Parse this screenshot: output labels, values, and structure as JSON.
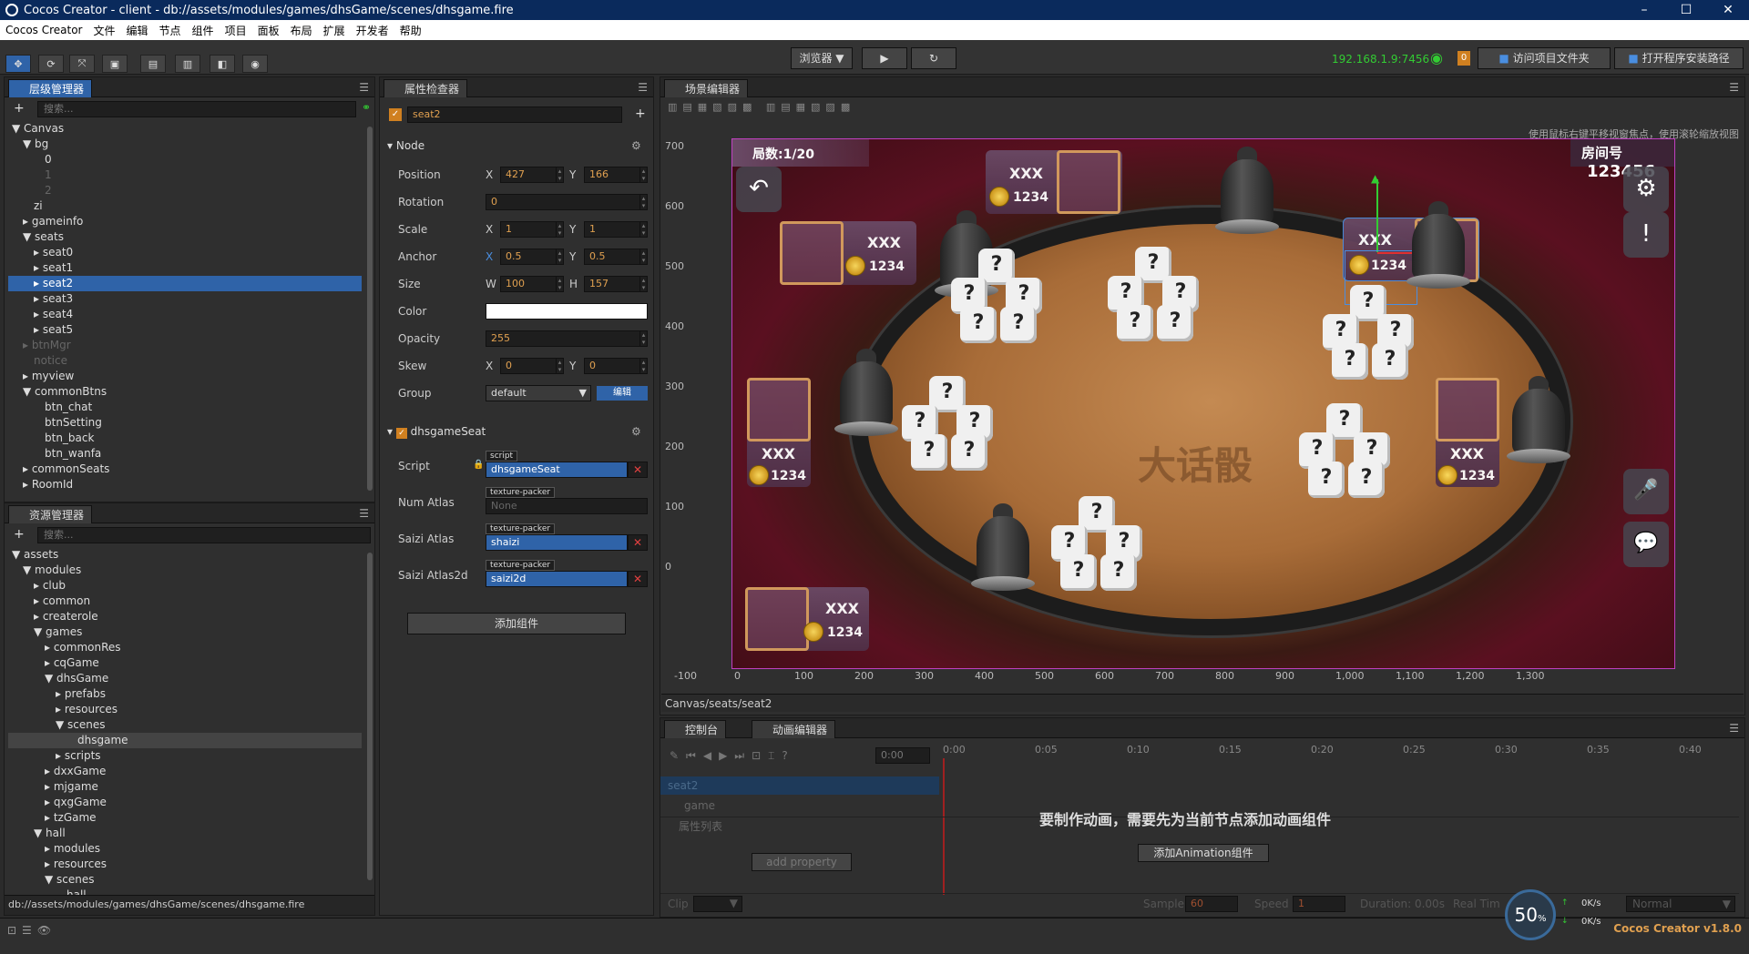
{
  "window": {
    "title": "Cocos Creator - client - db://assets/modules/games/dhsGame/scenes/dhsgame.fire",
    "min": "–",
    "max": "☐",
    "close": "✕"
  },
  "menu": [
    "Cocos Creator",
    "文件",
    "编辑",
    "节点",
    "组件",
    "项目",
    "面板",
    "布局",
    "扩展",
    "开发者",
    "帮助"
  ],
  "toolbar": {
    "preview_select": "浏览器 ▼",
    "play": "▶",
    "refresh": "↻",
    "ip": "192.168.1.9:7456",
    "wifi": "◉",
    "badge": "0",
    "open_project": "访问项目文件夹",
    "open_install": "打开程序安装路径"
  },
  "hierarchy": {
    "tab": "层级管理器",
    "search_placeholder": "搜索...",
    "nodes": [
      {
        "label": "▼ Canvas",
        "indent": 0,
        "state": ""
      },
      {
        "label": "▼ bg",
        "indent": 1,
        "state": ""
      },
      {
        "label": "0",
        "indent": 3,
        "state": ""
      },
      {
        "label": "1",
        "indent": 3,
        "state": "dim"
      },
      {
        "label": "2",
        "indent": 3,
        "state": "dim"
      },
      {
        "label": "zi",
        "indent": 2,
        "state": ""
      },
      {
        "label": "▸ gameinfo",
        "indent": 1,
        "state": ""
      },
      {
        "label": "▼ seats",
        "indent": 1,
        "state": ""
      },
      {
        "label": "▸ seat0",
        "indent": 2,
        "state": ""
      },
      {
        "label": "▸ seat1",
        "indent": 2,
        "state": ""
      },
      {
        "label": "▸ seat2",
        "indent": 2,
        "state": "sel"
      },
      {
        "label": "▸ seat3",
        "indent": 2,
        "state": ""
      },
      {
        "label": "▸ seat4",
        "indent": 2,
        "state": ""
      },
      {
        "label": "▸ seat5",
        "indent": 2,
        "state": ""
      },
      {
        "label": "▸ btnMgr",
        "indent": 1,
        "state": "dim"
      },
      {
        "label": "notice",
        "indent": 2,
        "state": "dim"
      },
      {
        "label": "▸ myview",
        "indent": 1,
        "state": ""
      },
      {
        "label": "▼ commonBtns",
        "indent": 1,
        "state": ""
      },
      {
        "label": "btn_chat",
        "indent": 3,
        "state": ""
      },
      {
        "label": "btnSetting",
        "indent": 3,
        "state": ""
      },
      {
        "label": "btn_back",
        "indent": 3,
        "state": ""
      },
      {
        "label": "btn_wanfa",
        "indent": 3,
        "state": ""
      },
      {
        "label": "▸ commonSeats",
        "indent": 1,
        "state": ""
      },
      {
        "label": "▸ RoomId",
        "indent": 1,
        "state": ""
      }
    ]
  },
  "assets": {
    "tab": "资源管理器",
    "search_placeholder": "搜索...",
    "nodes": [
      {
        "label": "▼ assets",
        "indent": 0,
        "state": ""
      },
      {
        "label": "▼ modules",
        "indent": 1,
        "state": ""
      },
      {
        "label": "▸ club",
        "indent": 2,
        "state": ""
      },
      {
        "label": "▸ common",
        "indent": 2,
        "state": ""
      },
      {
        "label": "▸ createrole",
        "indent": 2,
        "state": ""
      },
      {
        "label": "▼ games",
        "indent": 2,
        "state": ""
      },
      {
        "label": "▸ commonRes",
        "indent": 3,
        "state": ""
      },
      {
        "label": "▸ cqGame",
        "indent": 3,
        "state": ""
      },
      {
        "label": "▼ dhsGame",
        "indent": 3,
        "state": ""
      },
      {
        "label": "▸ prefabs",
        "indent": 4,
        "state": ""
      },
      {
        "label": "▸ resources",
        "indent": 4,
        "state": ""
      },
      {
        "label": "▼ scenes",
        "indent": 4,
        "state": ""
      },
      {
        "label": "dhsgame",
        "indent": 6,
        "state": "hl"
      },
      {
        "label": "▸ scripts",
        "indent": 4,
        "state": ""
      },
      {
        "label": "▸ dxxGame",
        "indent": 3,
        "state": ""
      },
      {
        "label": "▸ mjgame",
        "indent": 3,
        "state": ""
      },
      {
        "label": "▸ qxgGame",
        "indent": 3,
        "state": ""
      },
      {
        "label": "▸ tzGame",
        "indent": 3,
        "state": ""
      },
      {
        "label": "▼ hall",
        "indent": 2,
        "state": ""
      },
      {
        "label": "▸ modules",
        "indent": 3,
        "state": ""
      },
      {
        "label": "▸ resources",
        "indent": 3,
        "state": ""
      },
      {
        "label": "▼ scenes",
        "indent": 3,
        "state": ""
      },
      {
        "label": "hall",
        "indent": 5,
        "state": ""
      }
    ],
    "path": "db://assets/modules/games/dhsGame/scenes/dhsgame.fire"
  },
  "inspector": {
    "tab": "属性检查器",
    "node_name": "seat2",
    "node_section": "Node",
    "position": {
      "label": "Position",
      "x": "427",
      "y": "166"
    },
    "rotation": {
      "label": "Rotation",
      "value": "0"
    },
    "scale": {
      "label": "Scale",
      "x": "1",
      "y": "1"
    },
    "anchor": {
      "label": "Anchor",
      "x": "0.5",
      "y": "0.5"
    },
    "size": {
      "label": "Size",
      "w": "100",
      "h": "157"
    },
    "color_label": "Color",
    "opacity": {
      "label": "Opacity",
      "value": "255"
    },
    "skew": {
      "label": "Skew",
      "x": "0",
      "y": "0"
    },
    "group": {
      "label": "Group",
      "value": "default",
      "edit": "编辑"
    },
    "component": "dhsgameSeat",
    "script": {
      "label": "Script",
      "tag": "script",
      "value": "dhsgameSeat"
    },
    "num_atlas": {
      "label": "Num Atlas",
      "tag": "texture-packer",
      "value": "None"
    },
    "saizi_atlas": {
      "label": "Saizi Atlas",
      "tag": "texture-packer",
      "value": "shaizi"
    },
    "saizi_atlas2d": {
      "label": "Saizi Atlas2d",
      "tag": "texture-packer",
      "value": "saizi2d"
    },
    "add_component": "添加组件",
    "x_lbl": "X",
    "y_lbl": "Y",
    "w_lbl": "W",
    "h_lbl": "H"
  },
  "scene": {
    "tab": "场景编辑器",
    "hint": "使用鼠标右键平移视窗焦点，使用滚轮缩放视图",
    "v_ticks": [
      "700",
      "600",
      "500",
      "400",
      "300",
      "200",
      "100",
      "0"
    ],
    "h_ticks": [
      "-100",
      "0",
      "100",
      "200",
      "300",
      "400",
      "500",
      "600",
      "700",
      "800",
      "900",
      "1,000",
      "1,100",
      "1,200",
      "1,300"
    ],
    "breadcrumb": "Canvas/seats/seat2",
    "round": "局数:1/20",
    "room_label": "房间号",
    "room_no": "123456",
    "watermark": "大话骰",
    "seat_name": "XXX",
    "seat_score": "1234",
    "die_face": "?",
    "back": "↶",
    "settings": "⚙",
    "info": "!",
    "mic": "🎤",
    "chat": "💬"
  },
  "bottom": {
    "tab_console": "控制台",
    "tab_anim": "动画编辑器",
    "time": "0:00",
    "time_ticks": [
      "0:00",
      "0:05",
      "0:10",
      "0:15",
      "0:20",
      "0:25",
      "0:30",
      "0:35",
      "0:40"
    ],
    "node": "seat2",
    "child": "game",
    "prop_list": "属性列表",
    "message": "要制作动画，需要先为当前节点添加动画组件",
    "add_anim": "添加Animation组件",
    "add_property": "add property",
    "clip": "Clip",
    "sample_label": "Sample",
    "sample": "60",
    "speed_label": "Speed",
    "speed": "1",
    "duration": "Duration: 0.00s",
    "real_time": "Real Tim",
    "wrap": "Normal"
  },
  "status": {
    "version": "Cocos Creator v1.8.0",
    "zoom": "50",
    "net_up": "0K/s",
    "net_down": "0K/s"
  }
}
